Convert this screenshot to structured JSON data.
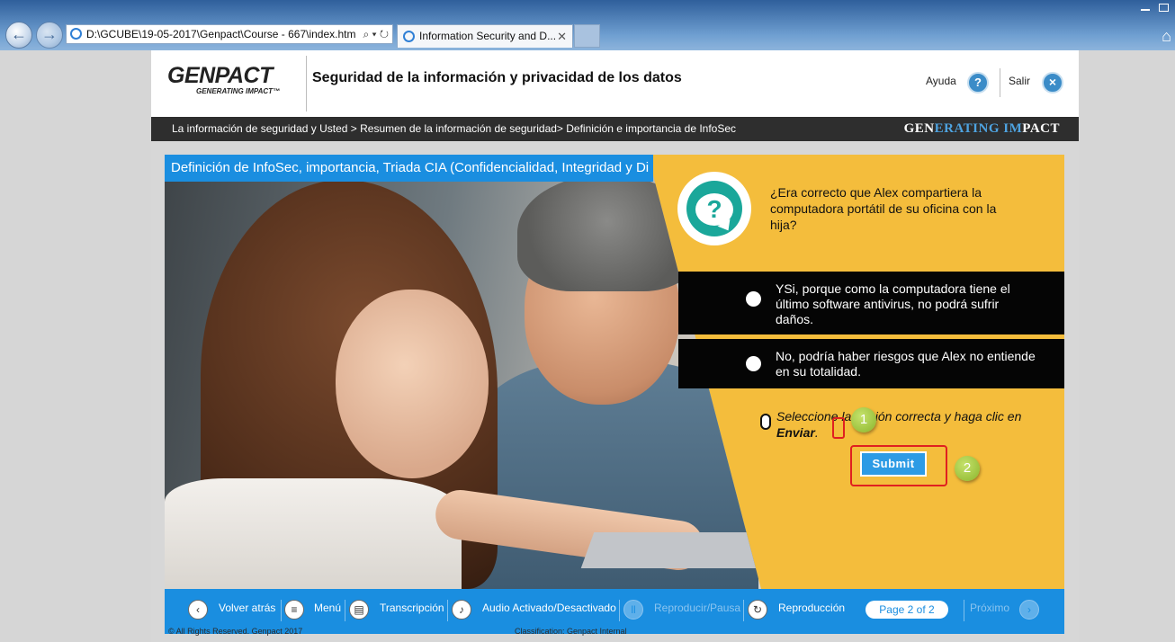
{
  "browser": {
    "address": "D:\\GCUBE\\19-05-2017\\Genpact\\Course - 667\\index.htm",
    "address_tools": "⌕ ▾ ↻",
    "tab_title": "Information Security and D...",
    "tab_close": "✕"
  },
  "header": {
    "logo_main": "GENPACT",
    "logo_tagline": "GENERATING IMPACT™",
    "title": "Seguridad de la información y privacidad de los datos",
    "help_label": "Ayuda",
    "exit_label": "Salir"
  },
  "breadcrumb": {
    "text": "La información de seguridad y Usted > Resumen de la información de seguridad> Definición e importancia de InfoSec",
    "brand_a": "GEN",
    "brand_b": "ERATING ",
    "brand_c": "IM",
    "brand_d": "PACT"
  },
  "slide": {
    "title": "Definición de InfoSec, importancia, Triada CIA (Confidencialidad, Integridad y Di",
    "question": "¿Era correcto que Alex compartiera la computadora portátil de su oficina con la hija?",
    "options": [
      {
        "text": "YSi, porque como la computadora tiene el último software antivirus, no podrá sufrir daños."
      },
      {
        "text": "No, podría haber riesgos que Alex no entiende en su totalidad."
      }
    ],
    "instruction_pre": "Seleccione la opción correcta y haga clic en ",
    "instruction_bold": "Enviar",
    "instruction_post": ".",
    "submit_label": "Submit",
    "callouts": [
      "1",
      "2"
    ]
  },
  "navbar": {
    "back": "Volver atrás",
    "menu": "Menú",
    "transcript": "Transcripción",
    "audio": "Audio Activado/Desactivado",
    "playpause": "Reproducir/Pausa",
    "replay": "Reproducción",
    "page": "Page 2 of 2",
    "next": "Próximo"
  },
  "footer": {
    "copyright": "© All Rights Reserved. Genpact 2017",
    "classification": "Classification: Genpact Internal"
  },
  "colors": {
    "accent_blue": "#1a8ee0",
    "slide_yellow": "#f4bd3c",
    "teal": "#1aa79a",
    "callout_red": "#e02020",
    "callout_green": "#8ab52c"
  }
}
